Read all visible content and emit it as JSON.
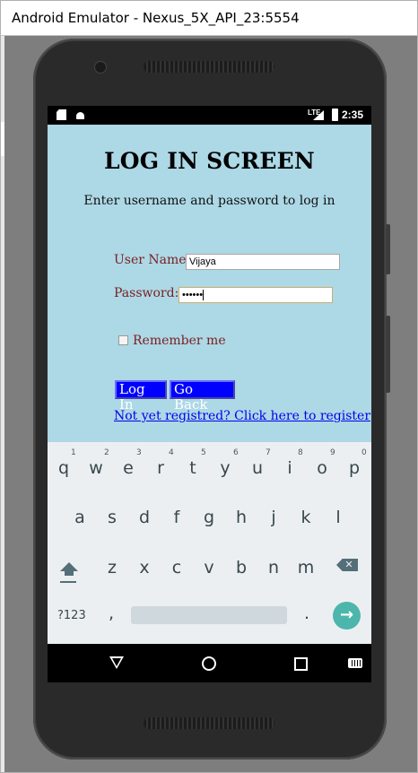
{
  "window": {
    "title": "Android Emulator - Nexus_5X_API_23:5554"
  },
  "statusbar": {
    "time": "2:35",
    "network": "LTE"
  },
  "login": {
    "heading": "LOG IN SCREEN",
    "subtitle": "Enter username and password to log in",
    "username_label": "User Name:",
    "username_value": "Vijaya",
    "password_label": "Password:",
    "password_value": "••••••",
    "remember_label": "Remember me",
    "remember_checked": false,
    "login_button": "Log In",
    "back_button": "Go Back",
    "register_link": "Not yet registred? Click here to register"
  },
  "keyboard": {
    "row1": [
      {
        "key": "q",
        "hint": ""
      },
      {
        "key": "w",
        "hint": "1"
      },
      {
        "key": "e",
        "hint": "2"
      },
      {
        "key": "r",
        "hint": "3"
      },
      {
        "key": "t",
        "hint": "4"
      },
      {
        "key": "y",
        "hint": "5"
      },
      {
        "key": "u",
        "hint": "6"
      },
      {
        "key": "i",
        "hint": "7"
      },
      {
        "key": "o",
        "hint": "8"
      },
      {
        "key": "p",
        "hint": "9"
      }
    ],
    "row1_last_hint": "0",
    "row2": [
      "a",
      "s",
      "d",
      "f",
      "g",
      "h",
      "j",
      "k",
      "l"
    ],
    "row3": [
      "z",
      "x",
      "c",
      "v",
      "b",
      "n",
      "m"
    ],
    "symbols_key": "?123",
    "comma_key": ",",
    "period_key": ".",
    "enter_icon": "arrow-right-icon",
    "shift_icon": "shift-icon",
    "backspace_icon": "backspace-icon"
  },
  "navbar": {
    "icons": [
      "back-icon",
      "home-icon",
      "recents-icon",
      "keyboard-switch-icon"
    ]
  },
  "colors": {
    "app_bg": "#add8e6",
    "button_bg": "#0000ff",
    "label_color": "#7a1f1f",
    "enter_key": "#4db6ac"
  }
}
